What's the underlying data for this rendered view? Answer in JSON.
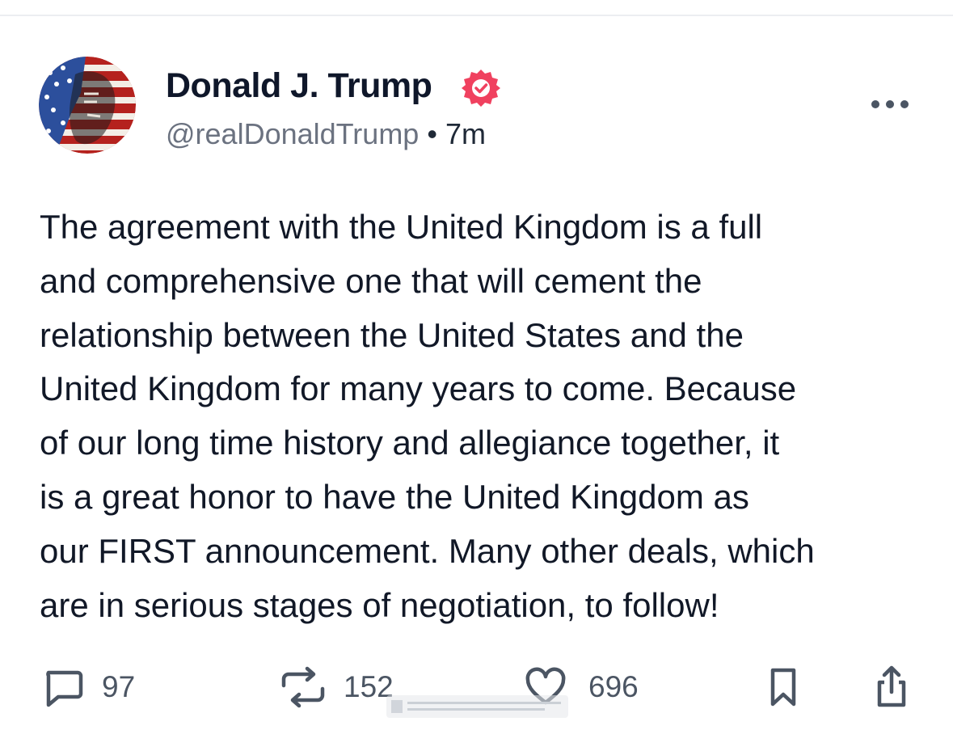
{
  "post": {
    "author": {
      "name": "Donald J. Trump",
      "handle": "@realDonaldTrump",
      "verified": true,
      "avatar_icon": "flag-portrait-avatar"
    },
    "separator": "•",
    "time": "7m",
    "body_lines": [
      "The agreement with the United Kingdom is a full",
      "and comprehensive one that will cement the",
      "relationship between the United States and the",
      "United Kingdom for many years to come. Because",
      "of our long time history and allegiance together, it",
      "is a great honor to have the United Kingdom as",
      "our FIRST announcement. Many other deals, which",
      "are in serious stages of negotiation, to follow!"
    ],
    "actions": {
      "replies": "97",
      "retruths": "152",
      "likes": "696"
    }
  },
  "colors": {
    "verified_badge": "#f0415f",
    "text_primary": "#111827",
    "text_secondary": "#6b7280",
    "icon": "#4b5563"
  },
  "icons": {
    "more": "more-dots-icon",
    "reply": "comment-bubble-icon",
    "retruth": "repost-arrows-icon",
    "like": "heart-icon",
    "bookmark": "bookmark-icon",
    "share": "share-upload-icon"
  }
}
